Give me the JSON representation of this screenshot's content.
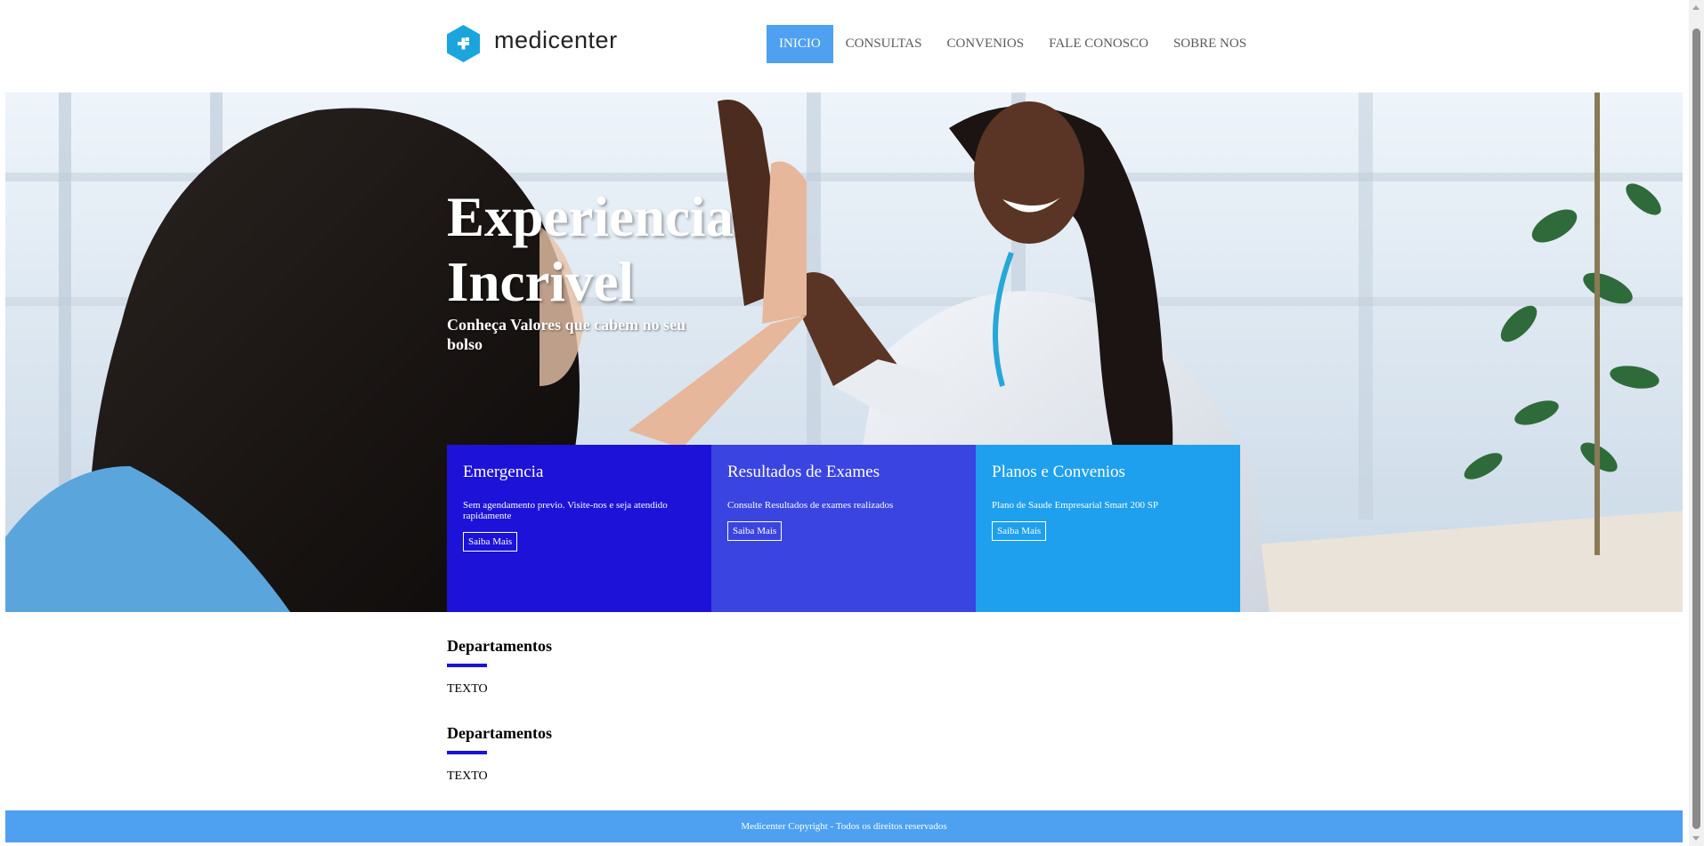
{
  "brand": {
    "name": "medicenter",
    "color": "#1aa5dc"
  },
  "nav": {
    "items": [
      {
        "label": "INICIO",
        "active": true
      },
      {
        "label": "CONSULTAS",
        "active": false
      },
      {
        "label": "CONVENIOS",
        "active": false
      },
      {
        "label": "FALE CONOSCO",
        "active": false
      },
      {
        "label": "SOBRE NOS",
        "active": false
      }
    ],
    "active_color": "#4ea0f0"
  },
  "hero": {
    "title": "Experiencia Incrivel",
    "subtitle": "Conheça Valores que cabem no seu bolso"
  },
  "cards": [
    {
      "title": "Emergencia",
      "text": "Sem agendamento previo. Visite-nos e seja atendido rapidamente",
      "button": "Saiba Mais",
      "color": "#1c12d8"
    },
    {
      "title": "Resultados de Exames",
      "text": "Consulte Resultados de exames realizados",
      "button": "Saiba Mais",
      "color": "#3a44e0"
    },
    {
      "title": "Planos e Convenios",
      "text": "Plano de Saude Empresarial Smart 200 SP",
      "button": "Saiba Mais",
      "color": "#1ea0ee"
    }
  ],
  "sections": [
    {
      "title": "Departamentos",
      "text": "TEXTO"
    },
    {
      "title": "Departamentos",
      "text": "TEXTO"
    }
  ],
  "footer": {
    "text": "Medicenter Copyright - Todos os direitos reservados",
    "color": "#4ea0f0"
  }
}
